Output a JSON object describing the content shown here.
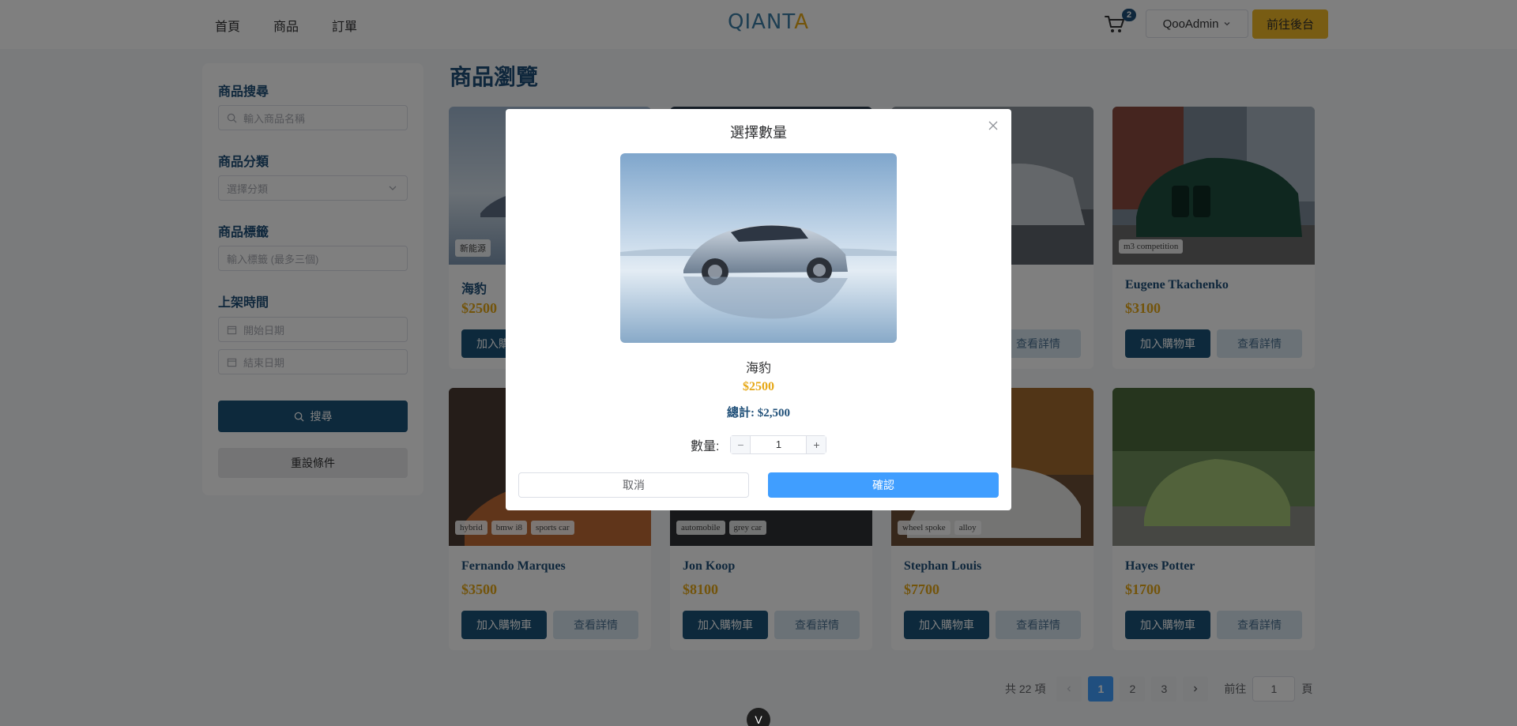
{
  "header": {
    "nav": [
      "首頁",
      "商品",
      "訂單"
    ],
    "logo_main": "QIANT",
    "logo_accent": "A",
    "cart_count": "2",
    "user_name": "QooAdmin",
    "admin_button": "前往後台"
  },
  "sidebar": {
    "search_label": "商品搜尋",
    "search_placeholder": "輸入商品名稱",
    "category_label": "商品分類",
    "category_placeholder": "選擇分類",
    "tags_label": "商品標籤",
    "tags_placeholder": "輸入標籤 (最多三個)",
    "date_label": "上架時間",
    "start_date_placeholder": "開始日期",
    "end_date_placeholder": "結束日期",
    "search_button": "搜尋",
    "reset_button": "重設條件"
  },
  "main": {
    "page_title": "商品瀏覽",
    "add_to_cart": "加入購物車",
    "view_details": "查看詳情",
    "products": [
      {
        "name": "海豹",
        "price": "$2500",
        "tags": [
          "新能源"
        ]
      },
      {
        "name": "",
        "price": "",
        "tags": []
      },
      {
        "name": "",
        "price": "",
        "tags": []
      },
      {
        "name": "Eugene Tkachenko",
        "price": "$3100",
        "tags": [
          "m3 competition"
        ]
      },
      {
        "name": "Fernando Marques",
        "price": "$3500",
        "tags": [
          "hybrid",
          "bmw i8",
          "sports car"
        ]
      },
      {
        "name": "Jon Koop",
        "price": "$8100",
        "tags": [
          "automobile",
          "grey car"
        ]
      },
      {
        "name": "Stephan Louis",
        "price": "$7700",
        "tags": [
          "wheel spoke",
          "alloy"
        ]
      },
      {
        "name": "Hayes Potter",
        "price": "$1700",
        "tags": []
      }
    ]
  },
  "pagination": {
    "total": "共 22 項",
    "pages": [
      "1",
      "2",
      "3"
    ],
    "current": "1",
    "goto_label": "前往",
    "goto_value": "1",
    "page_suffix": "頁"
  },
  "bottom_badge": "V",
  "modal": {
    "title": "選擇數量",
    "name": "海豹",
    "price": "$2500",
    "total": "總計: $2,500",
    "qty_label": "數量:",
    "qty_value": "1",
    "minus": "−",
    "plus": "+",
    "cancel": "取消",
    "confirm": "確認"
  },
  "colors": {
    "primary_dark": "#1a5379",
    "accent_gold": "#e6a817",
    "primary_blue": "#409eff"
  }
}
